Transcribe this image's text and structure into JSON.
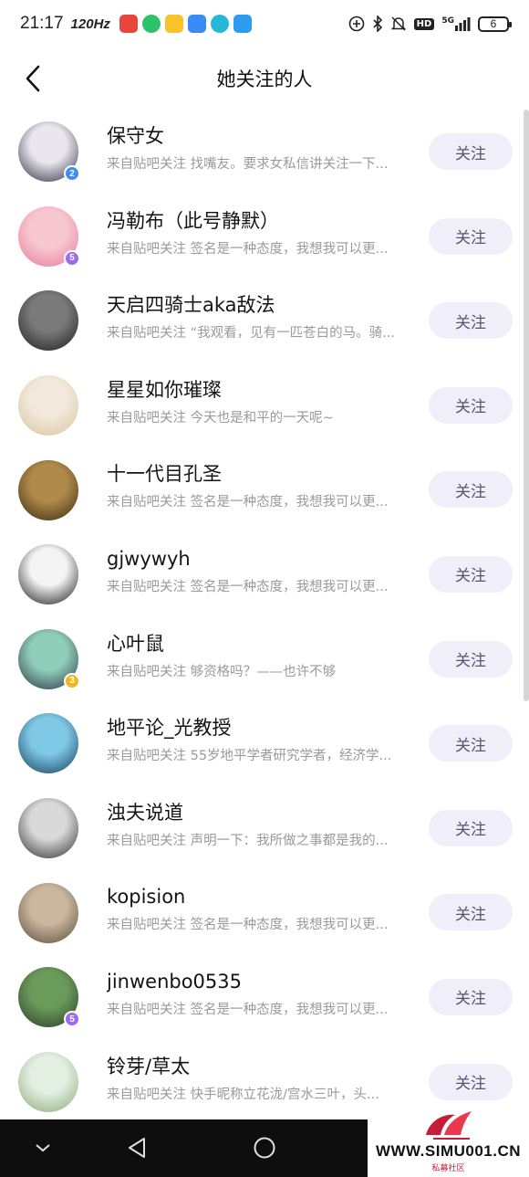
{
  "status_bar": {
    "time": "21:17",
    "refresh_rate": "120Hz",
    "hd_label": "HD",
    "network": "5G",
    "battery": "6"
  },
  "header": {
    "title": "她关注的人",
    "back_icon": "chevron-left-icon"
  },
  "users": [
    {
      "name": "保守女",
      "desc": "来自贴吧关注 找嘴友。要求女私信讲关注一下...",
      "button": "关注",
      "badge": "2",
      "badge_color": "#3d8bfd",
      "avatar_colors": [
        "#e9e6ee",
        "#2b2b3a"
      ]
    },
    {
      "name": "冯勒布（此号静默）",
      "desc": "来自贴吧关注 签名是一种态度，我想我可以更...",
      "button": "关注",
      "badge": "5",
      "badge_color": "#9c6cf0",
      "avatar_colors": [
        "#f7c8d2",
        "#e87a96"
      ]
    },
    {
      "name": "天启四骑士aka敌法",
      "desc": "来自贴吧关注 “我观看，见有一匹苍白的马。骑...",
      "button": "关注",
      "badge": "",
      "badge_color": "",
      "avatar_colors": [
        "#7a7a7a",
        "#1c1c1c"
      ]
    },
    {
      "name": "星星如你璀璨",
      "desc": "来自贴吧关注 今天也是和平的一天呢~",
      "button": "关注",
      "badge": "",
      "badge_color": "",
      "avatar_colors": [
        "#f2e9dc",
        "#d8c49a"
      ]
    },
    {
      "name": "十一代目孔圣",
      "desc": "来自贴吧关注 签名是一种态度，我想我可以更...",
      "button": "关注",
      "badge": "",
      "badge_color": "",
      "avatar_colors": [
        "#b08a4a",
        "#3a2a14"
      ]
    },
    {
      "name": "gjwywyh",
      "desc": "来自贴吧关注 签名是一种态度，我想我可以更...",
      "button": "关注",
      "badge": "",
      "badge_color": "",
      "avatar_colors": [
        "#f4f4f4",
        "#151515"
      ]
    },
    {
      "name": "心叶鼠",
      "desc": "来自贴吧关注 够资格吗？——也许不够",
      "button": "关注",
      "badge": "3",
      "badge_color": "#f0b81a",
      "avatar_colors": [
        "#8fcfb9",
        "#2a2f45"
      ]
    },
    {
      "name": "地平论_光教授",
      "desc": "来自贴吧关注 55岁地平学者研究学者，经济学...",
      "button": "关注",
      "badge": "",
      "badge_color": "",
      "avatar_colors": [
        "#7fc9e6",
        "#113a5a"
      ]
    },
    {
      "name": "浊夫说道",
      "desc": "来自贴吧关注 声明一下：我所做之事都是我的...",
      "button": "关注",
      "badge": "",
      "badge_color": "",
      "avatar_colors": [
        "#d9d9d9",
        "#2c2c2c"
      ]
    },
    {
      "name": "kopision",
      "desc": "来自贴吧关注 签名是一种态度，我想我可以更...",
      "button": "关注",
      "badge": "",
      "badge_color": "",
      "avatar_colors": [
        "#c9b89e",
        "#5a4a38"
      ]
    },
    {
      "name": "jinwenbo0535",
      "desc": "来自贴吧关注 签名是一种态度，我想我可以更...",
      "button": "关注",
      "badge": "5",
      "badge_color": "#9c6cf0",
      "avatar_colors": [
        "#6a9b5a",
        "#2a3a2a"
      ]
    },
    {
      "name": "铃芽/草太",
      "desc": "来自贴吧关注 快手昵称立花泷/宫水三叶，头...",
      "button": "关注",
      "badge": "",
      "badge_color": "",
      "avatar_colors": [
        "#e3efe0",
        "#8aa87a"
      ]
    }
  ],
  "nav": {
    "back_icon": "nav-back-triangle-icon",
    "home_icon": "nav-home-circle-icon",
    "down_icon": "nav-chevron-down-icon"
  },
  "watermark": {
    "text": "WWW.SIMU001.CN",
    "sub": "私募社区"
  }
}
